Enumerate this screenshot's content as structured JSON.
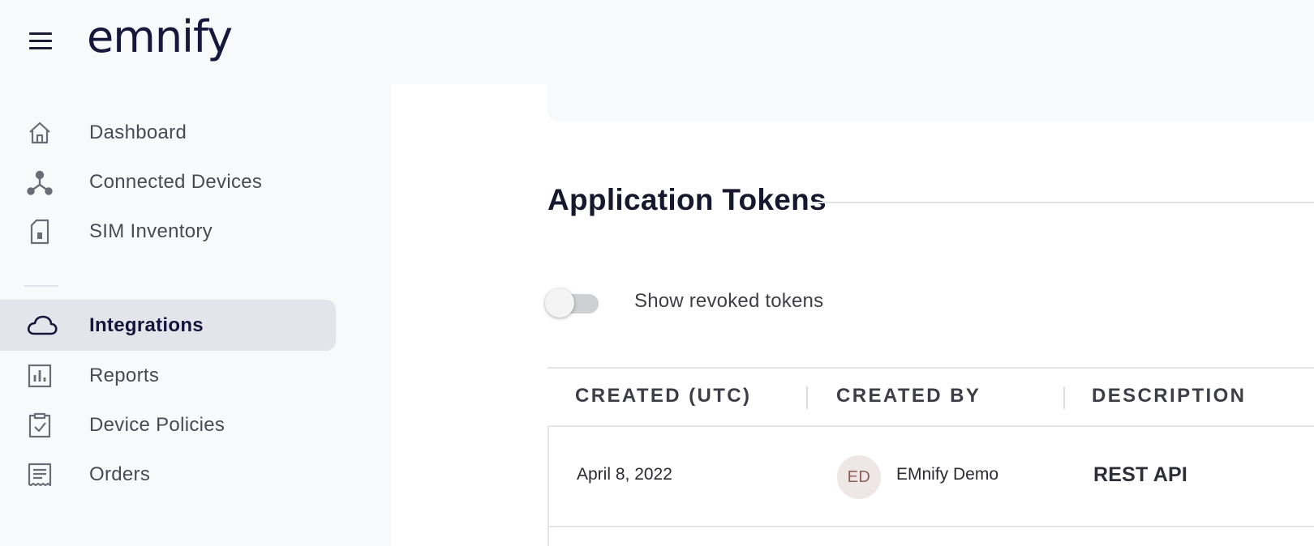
{
  "header": {
    "logo_text": "emnify"
  },
  "sidebar": {
    "items": [
      {
        "label": "Dashboard",
        "icon": "home-icon",
        "active": false
      },
      {
        "label": "Connected Devices",
        "icon": "network-icon",
        "active": false
      },
      {
        "label": "SIM Inventory",
        "icon": "sim-card-icon",
        "active": false
      },
      {
        "label": "Integrations",
        "icon": "cloud-icon",
        "active": true
      },
      {
        "label": "Reports",
        "icon": "bar-chart-icon",
        "active": false
      },
      {
        "label": "Device Policies",
        "icon": "clipboard-check-icon",
        "active": false
      },
      {
        "label": "Orders",
        "icon": "receipt-icon",
        "active": false
      }
    ]
  },
  "main": {
    "section_title": "Application Tokens",
    "toggle": {
      "label": "Show revoked tokens",
      "checked": false
    },
    "table": {
      "columns": [
        "CREATED (UTC)",
        "CREATED BY",
        "DESCRIPTION"
      ],
      "rows": [
        {
          "created": "April 8, 2022",
          "avatar_initials": "ED",
          "created_by": "EMnify Demo",
          "description": "REST API"
        }
      ]
    }
  },
  "colors": {
    "brand": "#17173c",
    "active_nav_bg": "#e4e5ea",
    "sidebar_bg": "#f8f9fb",
    "content_bg": "#ffffff",
    "avatar_bg": "#efe6e6",
    "avatar_text": "#8b5e60"
  }
}
